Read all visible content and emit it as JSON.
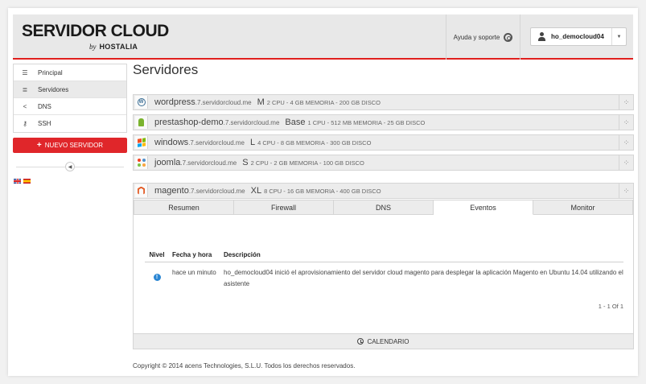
{
  "header": {
    "logo_main": "SERVIDOR CLOUD",
    "logo_by": "by",
    "logo_brand": "HOSTALIA",
    "help_label": "Ayuda y soporte",
    "username": "ho_democloud04",
    "accent_color": "#e0201e"
  },
  "sidebar": {
    "items": [
      {
        "label": "Principal",
        "icon": "list-icon"
      },
      {
        "label": "Servidores",
        "icon": "database-icon"
      },
      {
        "label": "DNS",
        "icon": "share-icon"
      },
      {
        "label": "SSH",
        "icon": "key-icon"
      }
    ],
    "new_server_label": "NUEVO SERVIDOR"
  },
  "main": {
    "title": "Servidores",
    "servers": [
      {
        "name": "wordpress",
        "domain": ".7.servidorcloud.me",
        "size": "M",
        "spec": "2 CPU - 4 GB MEMORIA - 200 GB DISCO",
        "icon": "wordpress-icon"
      },
      {
        "name": "prestashop-demo",
        "domain": ".7.servidorcloud.me",
        "size": "Base",
        "spec": "1 CPU - 512 MB MEMORIA - 25 GB DISCO",
        "icon": "prestashop-icon"
      },
      {
        "name": "windows",
        "domain": ".7.servidorcloud.me",
        "size": "L",
        "spec": "4 CPU - 8 GB MEMORIA - 300 GB DISCO",
        "icon": "windows-icon"
      },
      {
        "name": "joomla",
        "domain": ".7.servidorcloud.me",
        "size": "S",
        "spec": "2 CPU - 2 GB MEMORIA - 100 GB DISCO",
        "icon": "joomla-icon"
      }
    ],
    "expanded": {
      "name": "magento",
      "domain": ".7.servidorcloud.me",
      "size": "XL",
      "spec": "8 CPU - 16 GB MEMORIA - 400 GB DISCO",
      "icon": "magento-icon",
      "tabs": [
        "Resumen",
        "Firewall",
        "DNS",
        "Eventos",
        "Monitor"
      ],
      "active_tab": "Eventos",
      "events": {
        "headers": {
          "level": "Nivel",
          "date": "Fecha y hora",
          "desc": "Descripción"
        },
        "rows": [
          {
            "level_icon": "info-icon",
            "date": "hace un minuto",
            "desc": "ho_democloud04 inició el aprovisionamiento del servidor cloud magento para desplegar la aplicación Magento en Ubuntu 14.04 utilizando el asistente"
          }
        ],
        "pager": "1 - 1  Of 1"
      },
      "calendar_label": "CALENDARIO"
    }
  },
  "footer": {
    "copyright": "Copyright © 2014 acens Technologies, S.L.U. Todos los derechos reservados."
  }
}
